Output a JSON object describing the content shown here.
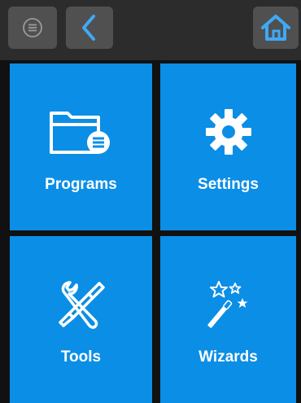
{
  "toolbar": {
    "menu_icon": "menu-icon",
    "back_icon": "back-icon",
    "home_icon": "home-icon"
  },
  "tiles": [
    {
      "label": "Programs",
      "icon": "folder-icon"
    },
    {
      "label": "Settings",
      "icon": "gear-icon"
    },
    {
      "label": "Tools",
      "icon": "tools-icon"
    },
    {
      "label": "Wizards",
      "icon": "wand-icon"
    }
  ],
  "colors": {
    "tile": "#0b8ee6",
    "toolbar": "#2c2c2c",
    "button": "#505050",
    "icon_accent": "#3fa9f5"
  }
}
